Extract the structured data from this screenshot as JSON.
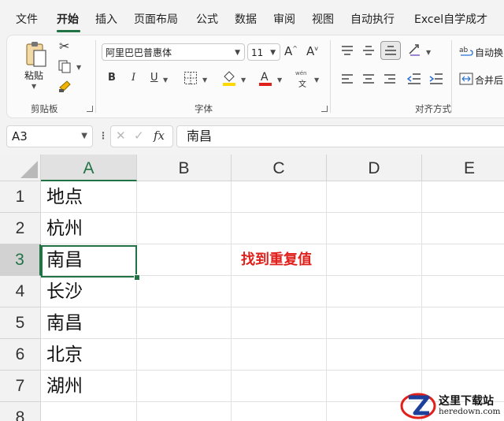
{
  "menu": {
    "tabs": [
      "文件",
      "开始",
      "插入",
      "页面布局",
      "公式",
      "数据",
      "审阅",
      "视图",
      "自动执行",
      "Excel自学成才"
    ],
    "active_index": 1
  },
  "ribbon": {
    "clipboard": {
      "paste_label": "粘贴",
      "group_label": "剪贴板"
    },
    "font": {
      "font_name": "阿里巴巴普惠体",
      "font_size": "11",
      "phonetic_label": "文",
      "group_label": "字体",
      "bold": "B",
      "italic": "I",
      "underline": "U",
      "grow": "A",
      "shrink": "A"
    },
    "alignment": {
      "wrap_label": "自动换",
      "merge_label": "合并后",
      "group_label": "对齐方式"
    }
  },
  "formula_bar": {
    "name_box": "A3",
    "fx_label": "fx",
    "content": "南昌"
  },
  "sheet": {
    "columns": [
      "A",
      "B",
      "C",
      "D",
      "E"
    ],
    "rows": [
      "1",
      "2",
      "3",
      "4",
      "5",
      "6",
      "7",
      "8"
    ],
    "cells_a": [
      "地点",
      "杭州",
      "南昌",
      "长沙",
      "南昌",
      "北京",
      "湖州"
    ],
    "note": "找到重复值",
    "note_color": "#e0201b",
    "accent_color": "#217346"
  },
  "watermark": {
    "line1": "这里下载站",
    "line2": "heredown.com"
  }
}
